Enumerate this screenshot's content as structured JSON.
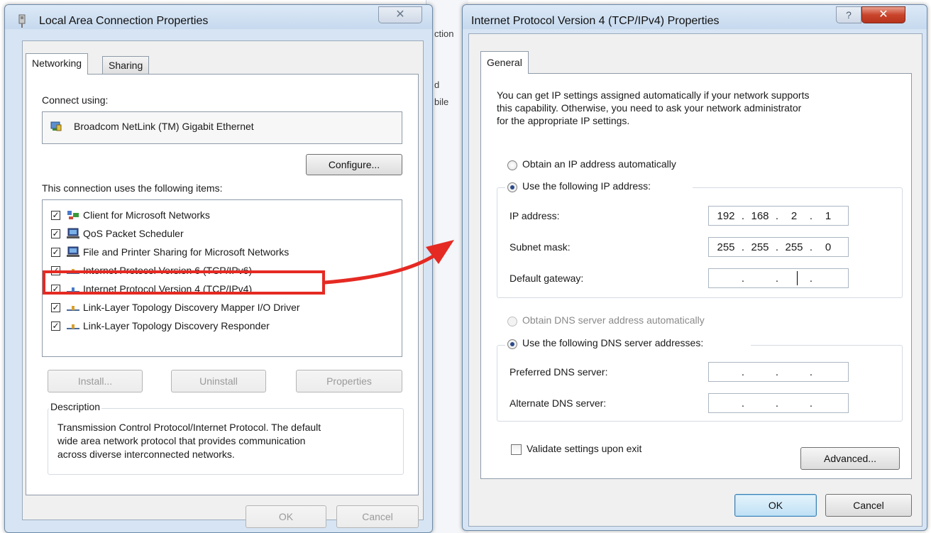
{
  "background": {
    "text_lines": [
      "ction",
      "d",
      "bile"
    ]
  },
  "left_dialog": {
    "title": "Local Area Connection Properties",
    "close_glyph": "✕",
    "tabs": [
      {
        "label": "Networking"
      },
      {
        "label": "Sharing"
      }
    ],
    "connect_using_label": "Connect using:",
    "adapter_name": "Broadcom NetLink (TM) Gigabit Ethernet",
    "configure_label": "Configure...",
    "items_label": "This connection uses the following items:",
    "items": [
      {
        "label": "Client for Microsoft Networks",
        "checked": true,
        "icon": "network-client-icon"
      },
      {
        "label": "QoS Packet Scheduler",
        "checked": true,
        "icon": "computer-icon"
      },
      {
        "label": "File and Printer Sharing for Microsoft Networks",
        "checked": true,
        "icon": "computer-icon"
      },
      {
        "label": "Internet Protocol Version 6 (TCP/IPv6)",
        "checked": true,
        "icon": "protocol-icon"
      },
      {
        "label": "Internet Protocol Version 4 (TCP/IPv4)",
        "checked": true,
        "icon": "protocol-icon",
        "highlighted": true
      },
      {
        "label": "Link-Layer Topology Discovery Mapper I/O Driver",
        "checked": true,
        "icon": "protocol-icon"
      },
      {
        "label": "Link-Layer Topology Discovery Responder",
        "checked": true,
        "icon": "protocol-icon"
      }
    ],
    "install_label": "Install...",
    "uninstall_label": "Uninstall",
    "properties_label": "Properties",
    "description_label": "Description",
    "description_lines": [
      "Transmission Control Protocol/Internet Protocol. The default",
      "wide area network protocol that provides communication",
      "across diverse interconnected networks."
    ],
    "ok_label": "OK",
    "cancel_label": "Cancel"
  },
  "right_dialog": {
    "title": "Internet Protocol Version 4 (TCP/IPv4) Properties",
    "help_glyph": "?",
    "close_glyph": "✕",
    "tab": "General",
    "intro_lines": [
      "You can get IP settings assigned automatically if your network supports",
      "this capability. Otherwise, you need to ask your network administrator",
      "for the appropriate IP settings."
    ],
    "obtain_ip_auto": "Obtain an IP address automatically",
    "use_following_ip": "Use the following IP address:",
    "ip_address_label": "IP address:",
    "ip_address": [
      "192",
      "168",
      "2",
      "1"
    ],
    "subnet_mask_label": "Subnet mask:",
    "subnet_mask": [
      "255",
      "255",
      "255",
      "0"
    ],
    "default_gateway_label": "Default gateway:",
    "default_gateway": [
      "",
      "",
      "",
      ""
    ],
    "obtain_dns_auto": "Obtain DNS server address automatically",
    "use_following_dns": "Use the following DNS server addresses:",
    "preferred_dns_label": "Preferred DNS server:",
    "preferred_dns": [
      "",
      "",
      "",
      ""
    ],
    "alternate_dns_label": "Alternate DNS server:",
    "alternate_dns": [
      "",
      "",
      "",
      ""
    ],
    "validate_label": "Validate settings upon exit",
    "advanced_label": "Advanced...",
    "ok_label": "OK",
    "cancel_label": "Cancel"
  },
  "annotation": {
    "color": "#e52a23"
  }
}
